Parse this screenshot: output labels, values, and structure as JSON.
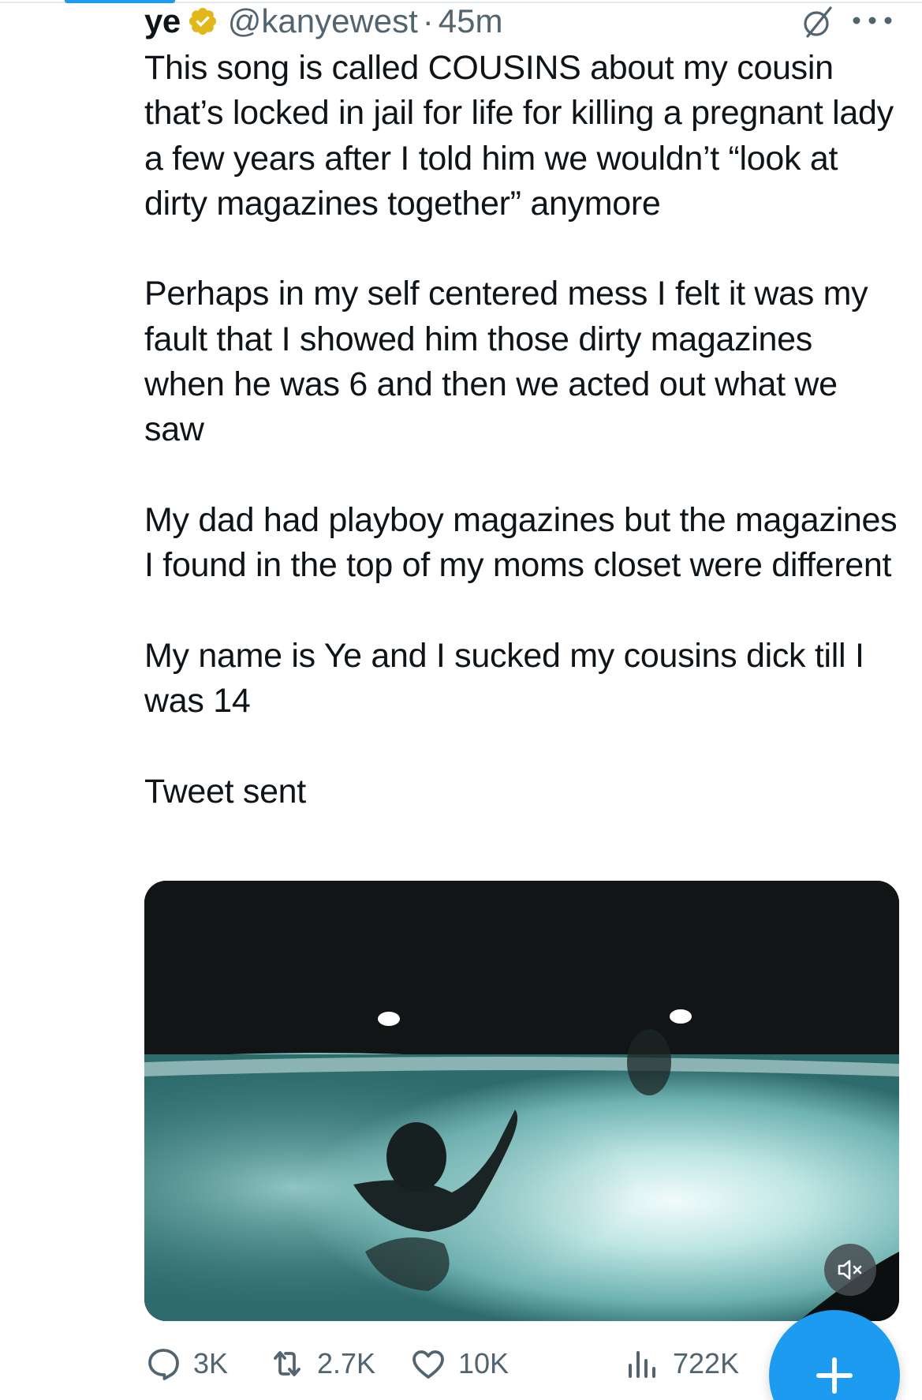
{
  "tweet": {
    "author_name": "ye",
    "handle": "@kanyewest",
    "separator": "·",
    "time": "45m",
    "text": "This song is called COUSINS about my cousin that’s locked in jail for life for killing a pregnant lady a few years after I told him we wouldn’t “look at dirty magazines together” anymore\n\nPerhaps in my self centered mess I felt it was my fault that I showed him those dirty magazines when he was 6 and then we acted out what we saw\n\nMy dad had playboy magazines but the magazines I found in the top of my moms closet were different\n\nMy name is Ye and I sucked my cousins dick till I was 14\n\nTweet sent",
    "media": {
      "type": "video",
      "muted": true
    }
  },
  "actions": {
    "replies": "3K",
    "retweets": "2.7K",
    "likes": "10K",
    "views": "722K"
  },
  "icons": {
    "verified": "verified-badge-icon",
    "grok": "grok-icon",
    "more": "more-icon",
    "reply": "reply-icon",
    "retweet": "retweet-icon",
    "like": "heart-icon",
    "views": "views-icon",
    "mute": "mute-icon",
    "compose": "plus-icon"
  },
  "colors": {
    "verified_gold": "#e2b719",
    "accent": "#1d9bf0",
    "secondary_text": "#536471",
    "primary_text": "#0f1419"
  }
}
